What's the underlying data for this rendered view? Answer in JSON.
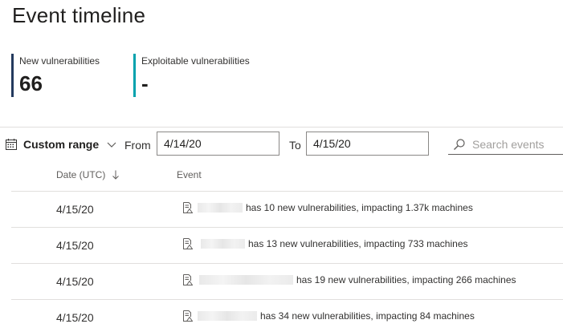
{
  "page": {
    "title": "Event timeline"
  },
  "cards": [
    {
      "label": "New vulnerabilities",
      "value": "66",
      "accent": "#243a5e"
    },
    {
      "label": "Exploitable vulnerabilities",
      "value": "-",
      "accent": "#00a2ad"
    }
  ],
  "filters": {
    "range_label": "Custom range",
    "from_label": "From",
    "from_value": "4/14/20",
    "to_label": "To",
    "to_value": "4/15/20",
    "search_placeholder": "Search events"
  },
  "table": {
    "columns": {
      "date": "Date (UTC)",
      "event": "Event"
    },
    "rows": [
      {
        "date": "4/15/20",
        "text": "has 10 new vulnerabilities, impacting 1.37k machines"
      },
      {
        "date": "4/15/20",
        "text": "has 13 new vulnerabilities, impacting 733 machines"
      },
      {
        "date": "4/15/20",
        "text": "has 19 new vulnerabilities, impacting 266 machines"
      },
      {
        "date": "4/15/20",
        "text": "has 34 new vulnerabilities, impacting 84 machines"
      }
    ]
  },
  "icons": {
    "calendar": "calendar-icon",
    "chevron": "chevron-down-icon",
    "search": "search-icon",
    "sort": "sort-descending-icon",
    "event": "document-vulnerability-icon"
  }
}
